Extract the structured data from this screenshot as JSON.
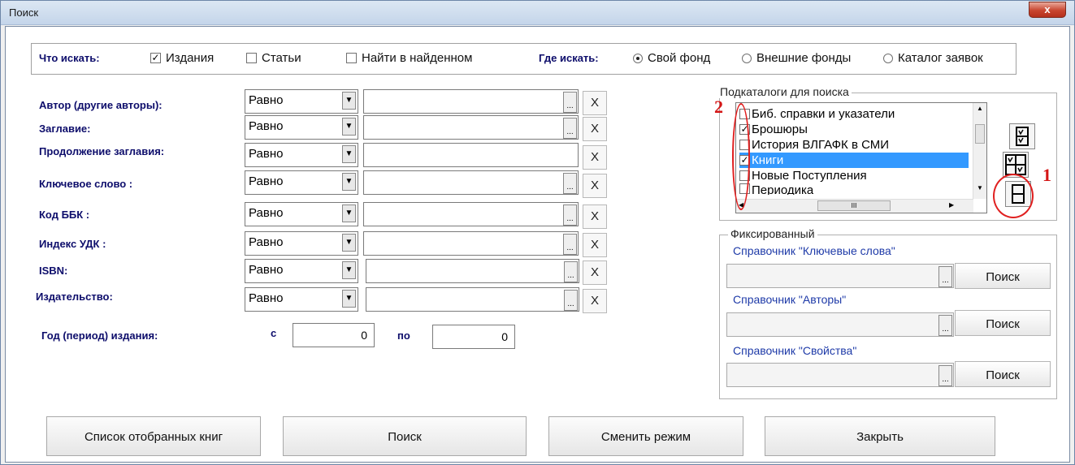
{
  "window": {
    "title": "Поиск",
    "close_symbol": "x"
  },
  "top": {
    "what_label": "Что искать:",
    "options": [
      {
        "label": "Издания",
        "checked": true
      },
      {
        "label": "Статьи",
        "checked": false
      },
      {
        "label": "Найти в найденном",
        "checked": false
      }
    ],
    "where_label": "Где искать:",
    "radios": [
      {
        "label": "Свой фонд",
        "selected": true
      },
      {
        "label": "Внешние фонды",
        "selected": false
      },
      {
        "label": "Каталог заявок",
        "selected": false
      }
    ]
  },
  "fields": [
    {
      "label": "Автор (другие авторы):",
      "operator": "Равно"
    },
    {
      "label": "Заглавие:",
      "operator": "Равно"
    },
    {
      "label": "Продолжение заглавия:",
      "operator": "Равно"
    },
    {
      "label": "Ключевое слово :",
      "operator": "Равно"
    },
    {
      "label": "Код ББК :",
      "operator": "Равно"
    },
    {
      "label": "Индекс УДК :",
      "operator": "Равно"
    },
    {
      "label": "ISBN:",
      "operator": "Равно"
    },
    {
      "label": "Издательство:",
      "operator": "Равно"
    }
  ],
  "year": {
    "label": "Год (период)  издания:",
    "from_label": "с",
    "from_value": "0",
    "to_label": "по",
    "to_value": "0"
  },
  "clear_symbol": "X",
  "browse_symbol": "...",
  "subcatalogs": {
    "title": "Подкаталоги для поиска",
    "items": [
      {
        "label": "Биб. справки и указатели",
        "checked": false,
        "selected": false
      },
      {
        "label": "Брошюры",
        "checked": true,
        "selected": false
      },
      {
        "label": "История ВЛГАФК в СМИ",
        "checked": false,
        "selected": false
      },
      {
        "label": "Книги",
        "checked": true,
        "selected": true
      },
      {
        "label": "Новые Поступления",
        "checked": false,
        "selected": false
      },
      {
        "label": "Периодика",
        "checked": false,
        "selected": false
      }
    ],
    "scroll_mark": "III"
  },
  "fixed": {
    "title": "Фиксированный",
    "refs": [
      {
        "label": "Справочник \"Ключевые слова\"",
        "button": "Поиск"
      },
      {
        "label": "Справочник \"Авторы\"",
        "button": "Поиск"
      },
      {
        "label": "Справочник \"Свойства\"",
        "button": "Поиск"
      }
    ]
  },
  "bottom": {
    "list_button": "Список отобранных книг",
    "search_button": "Поиск",
    "mode_button": "Сменить режим",
    "close_button": "Закрыть"
  },
  "annotations": {
    "mark1": "1",
    "mark2": "2"
  },
  "colors": {
    "accent": "#3399ff",
    "label_blue": "#0d0d6b",
    "ref_blue": "#1e3aa8",
    "annotation_red": "#d41616"
  }
}
